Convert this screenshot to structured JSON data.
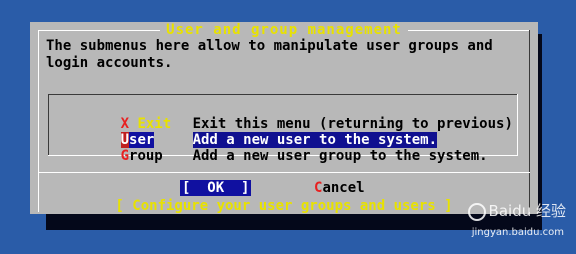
{
  "dialog": {
    "title": "User and group management",
    "description": "The submenus here allow to manipulate user groups and\nlogin accounts.",
    "menu_items": [
      {
        "hotkey": "X",
        "rest": " Exit",
        "description": "Exit this menu (returning to previous)"
      },
      {
        "hotkey": "U",
        "rest": "ser",
        "description": "Add a new user to the system."
      },
      {
        "hotkey": "G",
        "rest": "roup",
        "description": "Add a new user group to the system."
      }
    ],
    "ok_label": "[  OK  ]",
    "cancel_hotkey": "C",
    "cancel_rest": "ancel",
    "footer": "[ Configure your user groups and users ]"
  },
  "watermark": {
    "brand": "Baidu 经验",
    "url": "jingyan.baidu.com"
  },
  "colors": {
    "background": "#2a5ca8",
    "dialog": "#b8b8b8",
    "title": "#e8e200",
    "hotkey": "#e82020",
    "selection": "#1010a0"
  }
}
